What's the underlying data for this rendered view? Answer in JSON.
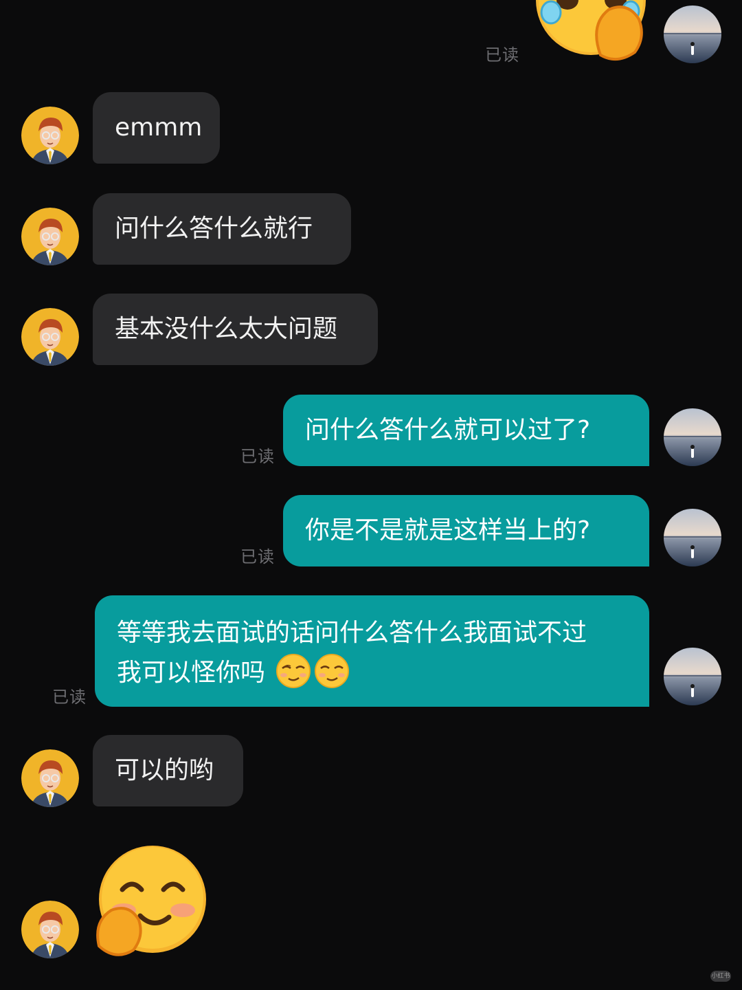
{
  "colors": {
    "background": "#0b0b0c",
    "incoming_bubble": "#2a2a2c",
    "outgoing_bubble": "#089c9d",
    "read_receipt": "#6e6e72"
  },
  "read_label": "已读",
  "messages": [
    {
      "side": "out",
      "type": "sticker",
      "sticker": "crying-laughing-sticker",
      "read": "已读"
    },
    {
      "side": "in",
      "type": "text",
      "text": "emmm"
    },
    {
      "side": "in",
      "type": "text",
      "text": "问什么答什么就行"
    },
    {
      "side": "in",
      "type": "text",
      "text": "基本没什么太大问题"
    },
    {
      "side": "out",
      "type": "text",
      "text": "问什么答什么就可以过了?",
      "read": "已读"
    },
    {
      "side": "out",
      "type": "text",
      "text": "你是不是就是这样当上的?",
      "read": "已读"
    },
    {
      "side": "out",
      "type": "text",
      "line1": "等等我去面试的话问什么答什么我面试不过",
      "line2": "我可以怪你吗",
      "emojis": [
        "smirk-emoji",
        "smirk-emoji"
      ],
      "read": "已读"
    },
    {
      "side": "in",
      "type": "text",
      "text": "可以的哟"
    },
    {
      "side": "in",
      "type": "sticker",
      "sticker": "shy-smile-sticker"
    }
  ],
  "watermark": "小红书"
}
